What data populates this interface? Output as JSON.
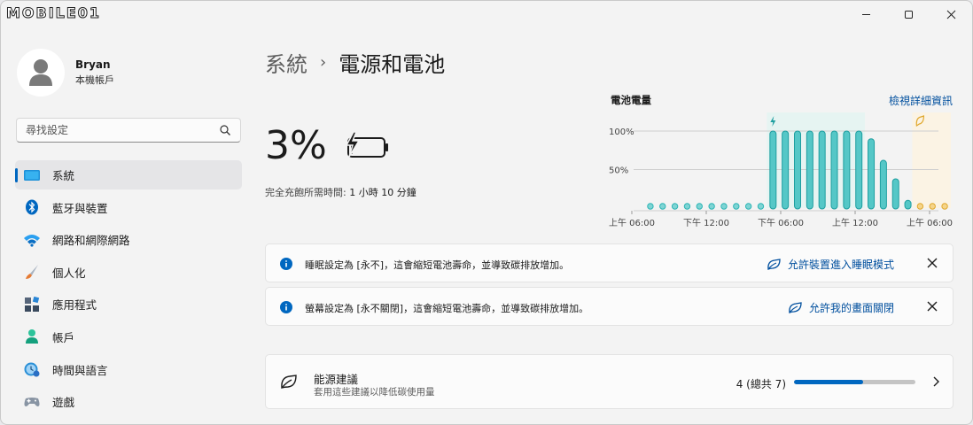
{
  "watermark": {
    "brand": "MOBILE01"
  },
  "window": {
    "controls": [
      "minimize",
      "maximize",
      "close"
    ]
  },
  "user": {
    "name": "Bryan",
    "account_type": "本機帳戶"
  },
  "search": {
    "placeholder": "尋找設定"
  },
  "nav": {
    "items": [
      {
        "label": "系統",
        "icon": "system-icon",
        "active": true,
        "color": "#0078d4"
      },
      {
        "label": "藍牙與裝置",
        "icon": "bluetooth-icon",
        "color": "#0067c0"
      },
      {
        "label": "網路和網際網路",
        "icon": "wifi-icon",
        "color": "#0a85d9"
      },
      {
        "label": "個人化",
        "icon": "brush-icon",
        "color": "#e07a3f"
      },
      {
        "label": "應用程式",
        "icon": "apps-icon",
        "color": "#3a4a5e"
      },
      {
        "label": "帳戶",
        "icon": "account-icon",
        "color": "#1fb28a"
      },
      {
        "label": "時間與語言",
        "icon": "clock-globe-icon",
        "color": "#2a8fd6"
      },
      {
        "label": "遊戲",
        "icon": "gamepad-icon",
        "color": "#7a8796"
      }
    ]
  },
  "breadcrumb": {
    "parent": "系統",
    "separator": "›",
    "current": "電源和電池"
  },
  "battery": {
    "percent_text": "3%",
    "level": 0.03,
    "charging": true,
    "time_label": "完全充飽所需時間:",
    "time_value": "1 小時 10 分鐘"
  },
  "chart_data": {
    "type": "bar",
    "title": "電池電量",
    "link": "檢視詳細資訊",
    "y_ticks": [
      "100%",
      "50%"
    ],
    "ylim": [
      0,
      100
    ],
    "x_ticks": [
      "上午 06:00",
      "下午 12:00",
      "下午 06:00",
      "上午 12:00",
      "上午 06:00"
    ],
    "values": [
      3,
      3,
      3,
      3,
      3,
      3,
      3,
      3,
      3,
      3,
      100,
      100,
      100,
      100,
      100,
      100,
      100,
      100,
      90,
      62,
      38,
      10,
      3,
      3,
      3
    ],
    "charging_window": [
      10,
      17
    ],
    "projected_window": [
      22,
      24
    ],
    "series_color": "#2cb5b5",
    "projected_color": "#e0a82e"
  },
  "notices": [
    {
      "message": "睡眠設定為 [永不]，這會縮短電池壽命，並導致碳排放增加。",
      "action": "允許裝置進入睡眠模式"
    },
    {
      "message": "螢幕設定為 [永不關閉]，這會縮短電池壽命，並導致碳排放增加。",
      "action": "允許我的畫面關閉"
    }
  ],
  "energy": {
    "title": "能源建議",
    "subtitle": "套用這些建議以降低碳使用量",
    "count_text": "4 (總共 7)",
    "progress": 0.57
  },
  "colors": {
    "accent": "#0067c0",
    "link": "#004f9e"
  }
}
